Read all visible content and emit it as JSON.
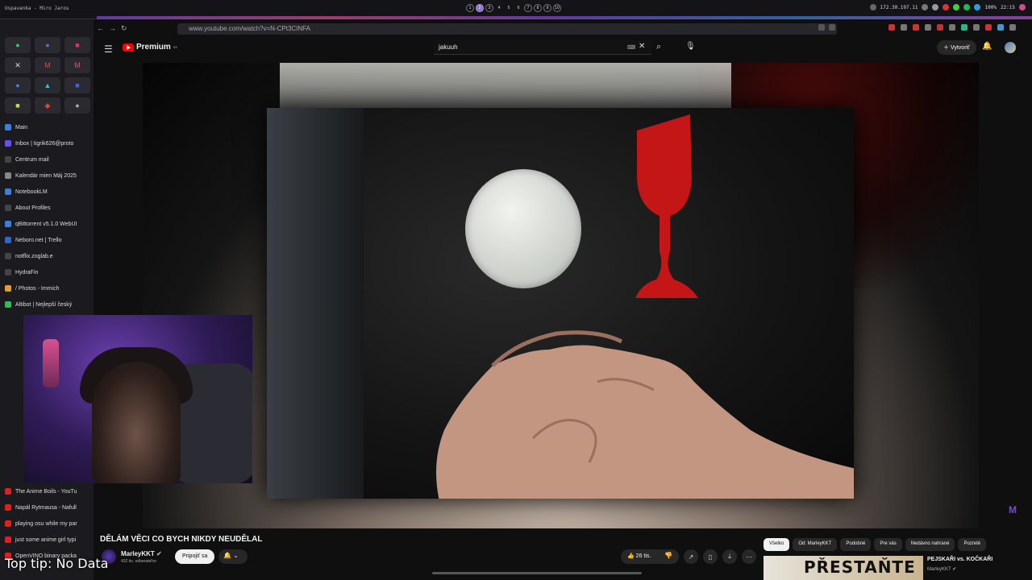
{
  "wm": {
    "title": "Uspavanka - Miro Jaros",
    "workspaces": [
      "1",
      "2",
      "3",
      "4",
      "5",
      "6",
      "7",
      "8",
      "9",
      "10"
    ],
    "active_workspace": "2",
    "ip": "172.30.197.11",
    "battery": "100%",
    "clock": "22:15"
  },
  "browser": {
    "url": "www.youtube.com/watch?v=N-CPt3CINFA"
  },
  "bookmarks": [
    {
      "label": "Main",
      "color": "#3a7ee0"
    },
    {
      "label": "Inbox | tigrik626@proto",
      "color": "#6d4aff"
    },
    {
      "label": "Centrum mail",
      "color": "#444"
    },
    {
      "label": "Kalendár mien Máj 2025",
      "color": "#888"
    },
    {
      "label": "NotebookLM",
      "color": "#3a7ee0"
    },
    {
      "label": "About Profiles",
      "color": "#444"
    },
    {
      "label": "qBittorrent v5.1.0 WebUI",
      "color": "#3a7ee0"
    },
    {
      "label": "Neboro.net | Trello",
      "color": "#2f66c9"
    },
    {
      "label": "notflix.zoglab.e",
      "color": "#444"
    },
    {
      "label": "HydraFin",
      "color": "#444"
    },
    {
      "label": "/ Photos - Immich",
      "color": "#e0a030"
    },
    {
      "label": "Altibot | Nejlepší český",
      "color": "#2fbf57"
    }
  ],
  "bookmarks_lower": [
    {
      "label": "The Anime Boils - YouTu",
      "color": "#e02020"
    },
    {
      "label": "Napál Rytmausa - Nafull",
      "color": "#e02020"
    },
    {
      "label": "playing osu while my par",
      "color": "#e02020"
    },
    {
      "label": "just some anime girl typi",
      "color": "#e02020"
    },
    {
      "label": "OpenVINO binary packa",
      "color": "#e02020"
    }
  ],
  "youtube": {
    "logo_text": "Premium",
    "logo_region": "SK",
    "search_value": "jakuuh",
    "create_label": "Vytvoriť"
  },
  "video": {
    "title": "DĚLÁM VĚCI CO BYCH NIKDY NEUDĚLAL",
    "channel": "MarleyKKT",
    "subscribers": "432 tis. odberateľov",
    "join_label": "Pripojiť sa",
    "likes": "26 tis."
  },
  "chips": [
    "Všetko",
    "Od: MarleyKKT",
    "Podobné",
    "Pre vás",
    "Nedávno nahrané",
    "Pozreté"
  ],
  "recommended": {
    "thumb_text": "PŘESTAŇTE",
    "title": "PEJSKAŘI vs. KOČKAŘI",
    "channel": "MarleyKKT"
  },
  "overlay": {
    "tip": "Top tip: No Data"
  }
}
